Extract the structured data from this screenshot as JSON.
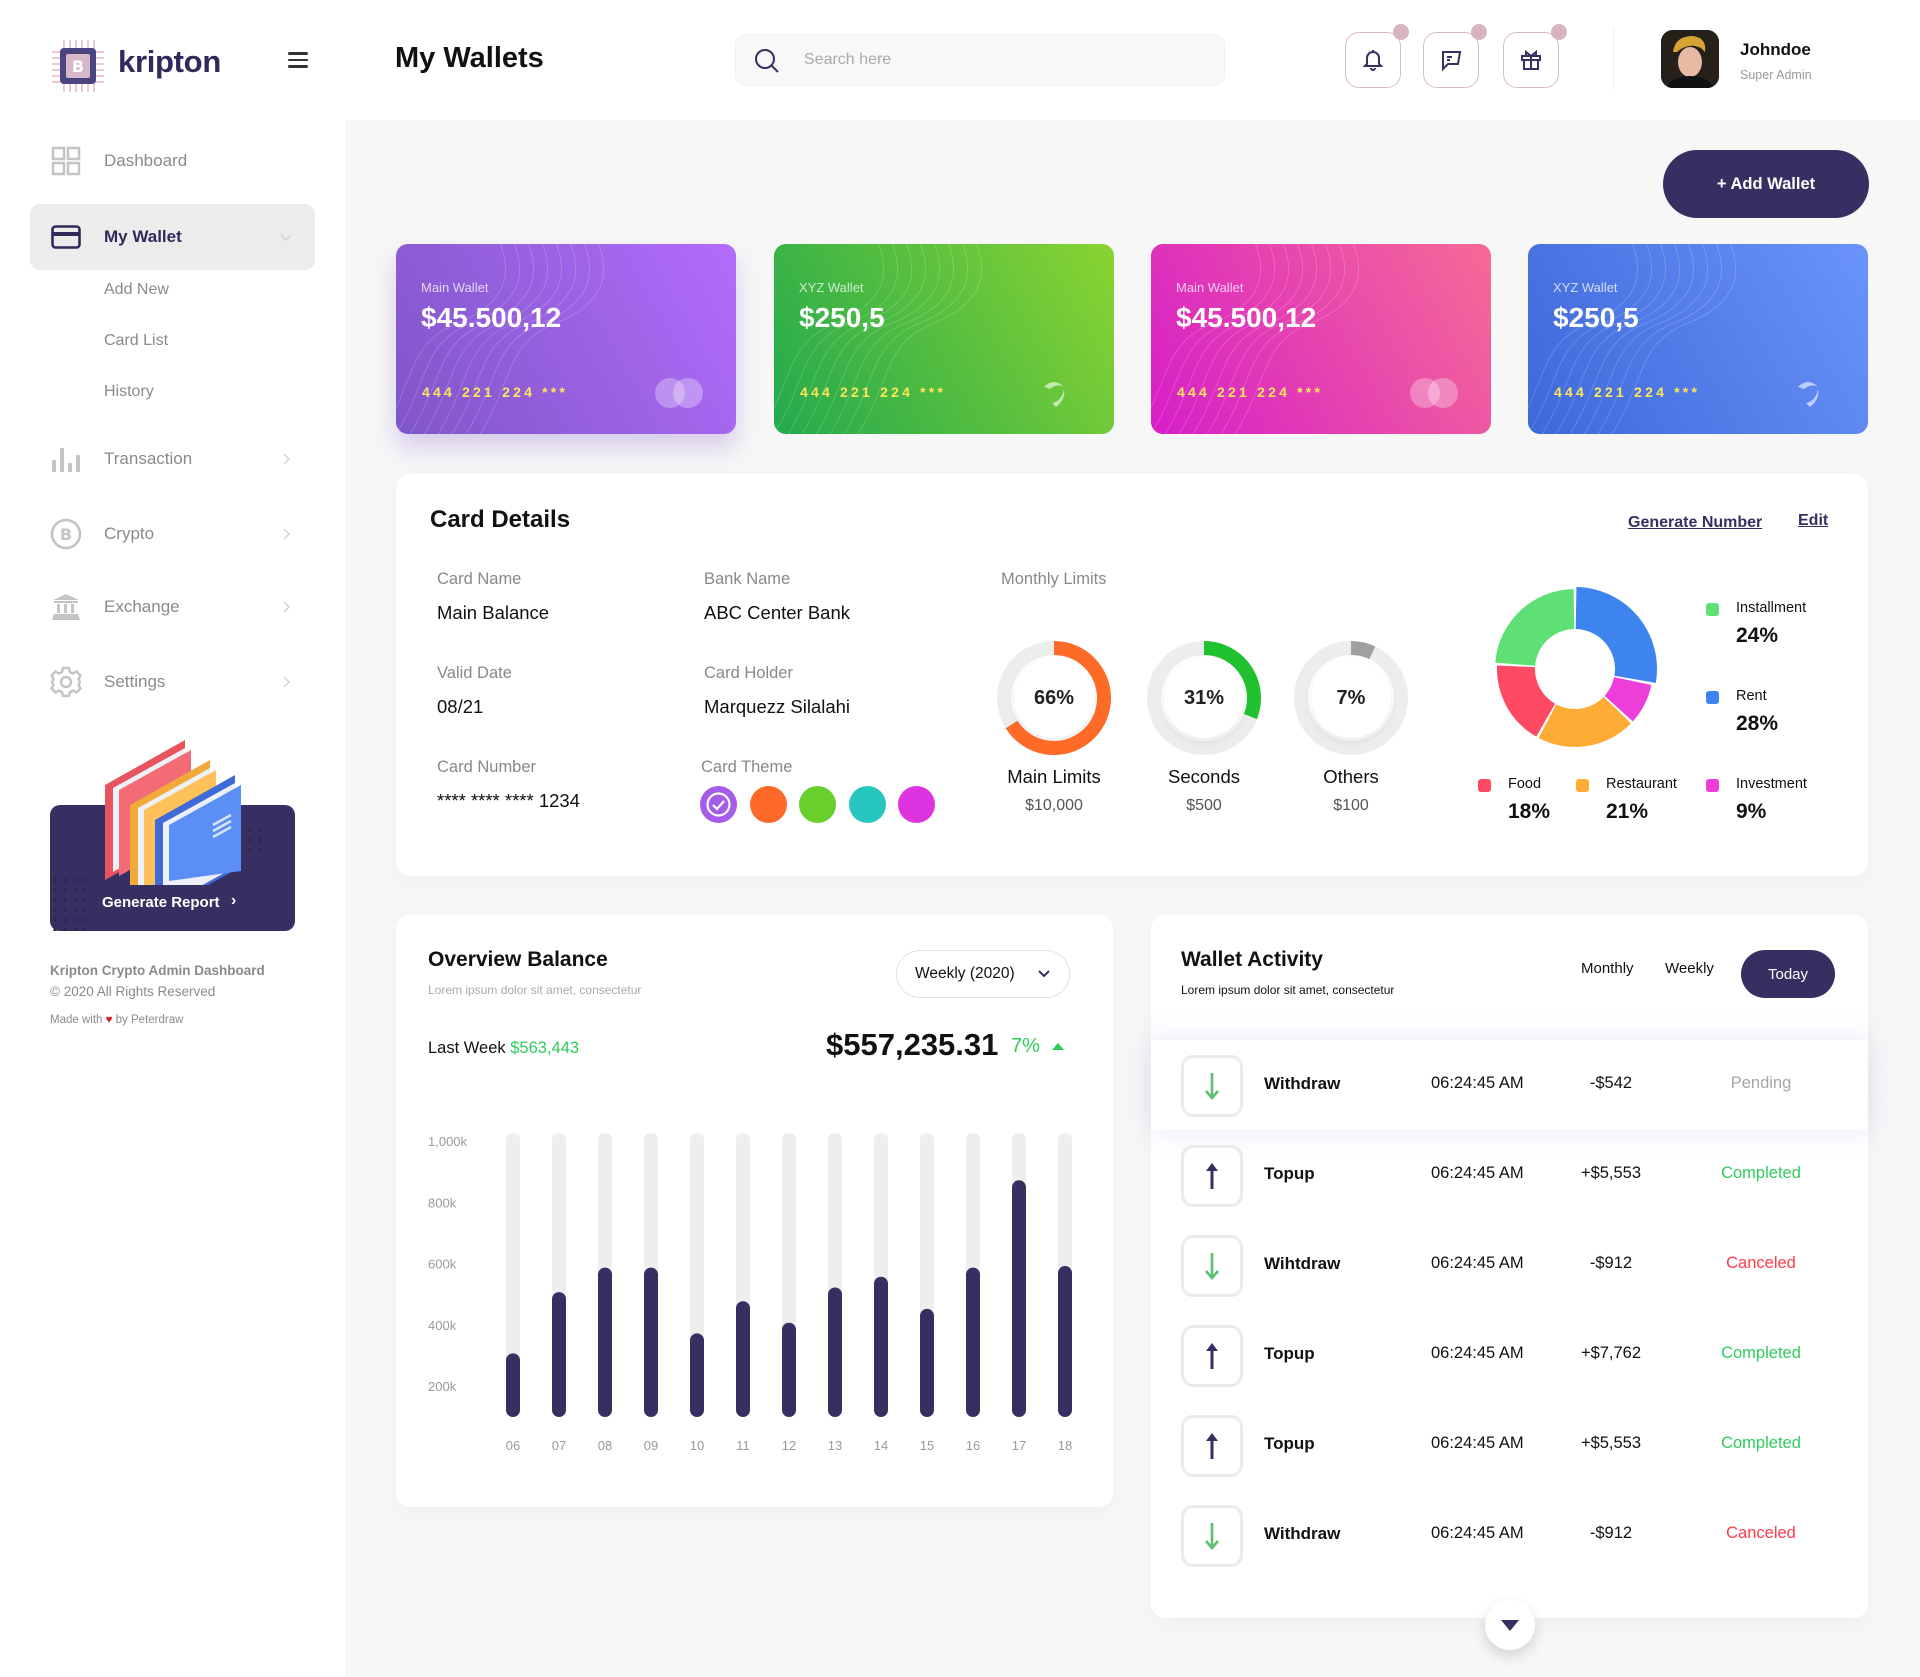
{
  "brand": {
    "name": "kripton"
  },
  "sidebar": {
    "items": [
      {
        "label": "Dashboard",
        "icon": "grid-icon"
      },
      {
        "label": "My Wallet",
        "icon": "credit-card-icon",
        "active": true
      },
      {
        "label": "Transaction",
        "icon": "bar-chart-icon"
      },
      {
        "label": "Crypto",
        "icon": "bitcoin-icon"
      },
      {
        "label": "Exchange",
        "icon": "bank-icon"
      },
      {
        "label": "Settings",
        "icon": "gear-icon"
      }
    ],
    "subitems": [
      "Add New",
      "Card List",
      "History"
    ],
    "report_button": "Generate Report",
    "footer": {
      "title": "Kripton Crypto Admin Dashboard",
      "copyright": "© 2020 All Rights Reserved",
      "made_prefix": "Made with",
      "made_suffix": "by Peterdraw"
    }
  },
  "header": {
    "title": "My Wallets",
    "search_placeholder": "Search here",
    "user": {
      "name": "Johndoe",
      "role": "Super Admin"
    }
  },
  "add_wallet_label": "+ Add Wallet",
  "wallets": [
    {
      "name": "Main Wallet",
      "amount": "$45.500,12",
      "number": "444 221 224 ***",
      "logo": "mastercard-icon",
      "gradient": [
        "#7e56c8",
        "#b36cfa"
      ]
    },
    {
      "name": "XYZ Wallet",
      "amount": "$250,5",
      "number": "444 221 224 ***",
      "logo": "swoosh-icon",
      "gradient": [
        "#22a94d",
        "#8ad431"
      ]
    },
    {
      "name": "Main Wallet",
      "amount": "$45.500,12",
      "number": "444 221 224 ***",
      "logo": "mastercard-icon",
      "gradient": [
        "#d61ec8",
        "#f66b96"
      ]
    },
    {
      "name": "XYZ Wallet",
      "amount": "$250,5",
      "number": "444 221 224 ***",
      "logo": "swoosh-icon",
      "gradient": [
        "#3d68d8",
        "#6b93fb"
      ]
    }
  ],
  "card_details": {
    "title": "Card Details",
    "generate_label": "Generate Number",
    "edit_label": "Edit",
    "fields": {
      "card_name": {
        "label": "Card Name",
        "value": "Main Balance"
      },
      "bank_name": {
        "label": "Bank Name",
        "value": "ABC Center Bank"
      },
      "valid_date": {
        "label": "Valid Date",
        "value": "08/21"
      },
      "card_holder": {
        "label": "Card Holder",
        "value": "Marquezz Silalahi"
      },
      "card_number": {
        "label": "Card Number",
        "value": "**** **** **** 1234"
      },
      "card_theme": {
        "label": "Card Theme"
      }
    },
    "themes": [
      "#a55ce8",
      "#ff6a2a",
      "#68cf2d",
      "#27c7bf",
      "#dd34e0"
    ],
    "selected_theme": 0,
    "monthly_limits_label": "Monthly Limits",
    "limits": [
      {
        "name": "Main Limits",
        "amount": "$10,000",
        "percent": 66,
        "pct_label": "66%",
        "color": "#fd6b26"
      },
      {
        "name": "Seconds",
        "amount": "$500",
        "percent": 31,
        "pct_label": "31%",
        "color": "#1fc22e"
      },
      {
        "name": "Others",
        "amount": "$100",
        "percent": 7,
        "pct_label": "7%",
        "color": "#a0a0a0"
      }
    ],
    "spending": [
      {
        "name": "Installment",
        "percent": 24,
        "label": "24%",
        "color": "#5fe074"
      },
      {
        "name": "Rent",
        "percent": 28,
        "label": "28%",
        "color": "#3d84ef"
      },
      {
        "name": "Food",
        "percent": 18,
        "label": "18%",
        "color": "#ff4a63"
      },
      {
        "name": "Restaurant",
        "percent": 21,
        "label": "21%",
        "color": "#ffac37"
      },
      {
        "name": "Investment",
        "percent": 9,
        "label": "9%",
        "color": "#ee3ed9"
      }
    ]
  },
  "overview": {
    "title": "Overview Balance",
    "subtitle": "Lorem ipsum dolor sit amet, consectetur",
    "period": "Weekly (2020)",
    "last_week_label": "Last Week",
    "last_week_value": "$563,443",
    "balance": "$557,235.31",
    "change": "7%"
  },
  "chart_data": {
    "type": "bar",
    "title": "Overview Balance",
    "xlabel": "",
    "ylabel": "",
    "categories": [
      "06",
      "07",
      "08",
      "09",
      "10",
      "11",
      "12",
      "13",
      "14",
      "15",
      "16",
      "17",
      "18"
    ],
    "values": [
      310,
      510,
      590,
      590,
      375,
      480,
      410,
      525,
      560,
      455,
      590,
      875,
      595
    ],
    "unit": "k",
    "yticks": [
      "200k",
      "400k",
      "600k",
      "800k",
      "1,000k"
    ],
    "ytick_values": [
      200,
      400,
      600,
      800,
      1000
    ],
    "ylim": [
      100,
      1030
    ],
    "grid": false
  },
  "activity": {
    "title": "Wallet Activity",
    "subtitle": "Lorem ipsum dolor sit amet, consectetur",
    "tabs": [
      "Monthly",
      "Weekly",
      "Today"
    ],
    "active_tab": "Today",
    "rows": [
      {
        "type": "Withdraw",
        "dir": "down",
        "time": "06:24:45 AM",
        "amount": "-$542",
        "status": "Pending",
        "status_color": "#a5a5a5"
      },
      {
        "type": "Topup",
        "dir": "up",
        "time": "06:24:45 AM",
        "amount": "+$5,553",
        "status": "Completed",
        "status_color": "#2ecc5b"
      },
      {
        "type": "Wihtdraw",
        "dir": "down",
        "time": "06:24:45 AM",
        "amount": "-$912",
        "status": "Canceled",
        "status_color": "#ff3b4a"
      },
      {
        "type": "Topup",
        "dir": "up",
        "time": "06:24:45 AM",
        "amount": "+$7,762",
        "status": "Completed",
        "status_color": "#2ecc5b"
      },
      {
        "type": "Topup",
        "dir": "up",
        "time": "06:24:45 AM",
        "amount": "+$5,553",
        "status": "Completed",
        "status_color": "#2ecc5b"
      },
      {
        "type": "Withdraw",
        "dir": "down",
        "time": "06:24:45 AM",
        "amount": "-$912",
        "status": "Canceled",
        "status_color": "#ff3b4a"
      }
    ]
  },
  "colors": {
    "primary": "#363062",
    "accent_green": "#2ecc5b",
    "danger": "#ff3b4a"
  }
}
